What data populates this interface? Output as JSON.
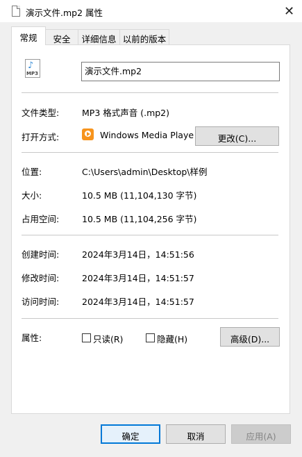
{
  "window": {
    "title": "演示文件.mp2 属性",
    "close": "✕"
  },
  "tabs": [
    "常规",
    "安全",
    "详细信息",
    "以前的版本"
  ],
  "file": {
    "icon_label": "MP3",
    "name": "演示文件.mp2"
  },
  "labels": {
    "file_type": "文件类型:",
    "opens_with": "打开方式:",
    "location": "位置:",
    "size": "大小:",
    "size_on_disk": "占用空间:",
    "created": "创建时间:",
    "modified": "修改时间:",
    "accessed": "访问时间:",
    "attributes": "属性:"
  },
  "values": {
    "file_type": "MP3 格式声音 (.mp2)",
    "opens_with": "Windows Media Playe",
    "location": "C:\\Users\\admin\\Desktop\\样例",
    "size": "10.5 MB (11,104,130 字节)",
    "size_on_disk": "10.5 MB (11,104,256 字节)",
    "created": "2024年3月14日，14:51:56",
    "modified": "2024年3月14日，14:51:57",
    "accessed": "2024年3月14日，14:51:57"
  },
  "buttons": {
    "change": "更改(C)...",
    "advanced": "高级(D)...",
    "ok": "确定",
    "cancel": "取消",
    "apply": "应用(A)"
  },
  "checkboxes": {
    "readonly": "只读(R)",
    "hidden": "隐藏(H)"
  }
}
